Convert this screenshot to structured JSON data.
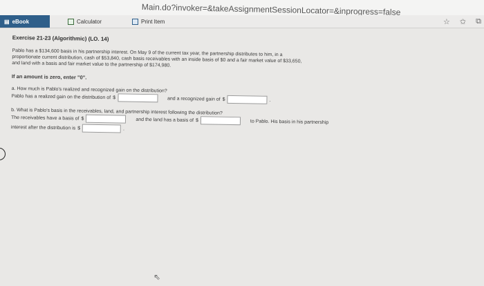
{
  "browser": {
    "url": "Main.do?invoker=&takeAssignmentSessionLocator=&inprogress=false",
    "star_icon": "star-icon",
    "favorites_icon": "favorites-icon",
    "share_icon": "share-icon"
  },
  "toolbar": {
    "ebook_label": "eBook",
    "calculator_label": "Calculator",
    "print_label": "Print Item"
  },
  "exercise": {
    "title": "Exercise 21-23 (Algorithmic) (LO. 14)",
    "paragraph_line1": "Pablo has a $134,600 basis in his partnership interest. On May 9 of the current tax year, the partnership distributes to him, in a",
    "paragraph_line2": "proportionate current distribution, cash of $53,840, cash basis receivables with an inside basis of $0 and a fair market value of $33,650,",
    "paragraph_line3": "and land with a basis and fair market value to the partnership of $174,980.",
    "zero_note": "If an amount is zero, enter \"0\".",
    "part_a": {
      "question": "a.  How much is Pablo's realized and recognized gain on the distribution?",
      "text1": "Pablo has a realized gain on the distribution of",
      "currency": "$",
      "text2": "and a recognized gain of",
      "end": ".",
      "realized_gain_value": "",
      "recognized_gain_value": ""
    },
    "part_b": {
      "question": "b.  What is Pablo's basis in the receivables, land, and partnership interest following the distribution?",
      "text1": "The receivables have a basis of",
      "currency": "$",
      "text2": "and the land has a basis of",
      "text3": "to Pablo. His basis in his partnership",
      "text4": "interest after the distribution is",
      "end": ".",
      "receivables_value": "",
      "land_value": "",
      "interest_value": ""
    }
  }
}
